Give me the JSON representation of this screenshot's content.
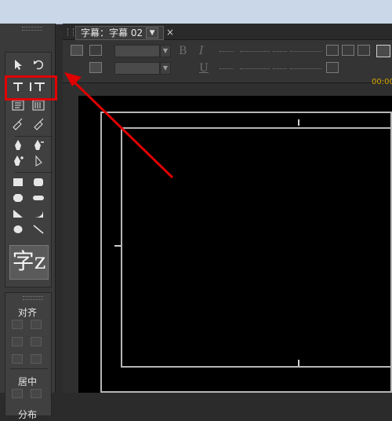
{
  "window": {
    "tab_title": "字幕：字幕 02",
    "tab_menu_symbol": "▼",
    "tab_close_symbol": "×"
  },
  "tools_panel": {
    "tools": [
      {
        "name": "selection-tool",
        "glyph": "↖"
      },
      {
        "name": "rotation-tool",
        "glyph": "↻"
      },
      {
        "name": "type-tool",
        "glyph": "T"
      },
      {
        "name": "vertical-type-tool",
        "glyph": "IT"
      },
      {
        "name": "area-type-tool",
        "glyph": "▤"
      },
      {
        "name": "vertical-area-type-tool",
        "glyph": "▥"
      },
      {
        "name": "path-type-tool",
        "glyph": "⟡"
      },
      {
        "name": "vertical-path-type-tool",
        "glyph": "⟢"
      },
      {
        "name": "pen-tool",
        "glyph": "✒"
      },
      {
        "name": "delete-anchor-tool",
        "glyph": "✒−"
      },
      {
        "name": "add-anchor-tool",
        "glyph": "✒+"
      },
      {
        "name": "convert-anchor-tool",
        "glyph": "⊳"
      },
      {
        "name": "rectangle-tool",
        "glyph": "■"
      },
      {
        "name": "rounded-rectangle-tool",
        "glyph": "▢"
      },
      {
        "name": "clipped-corner-rectangle-tool",
        "glyph": "⬢"
      },
      {
        "name": "rounded-corner-rectangle-tool",
        "glyph": "▬"
      },
      {
        "name": "wedge-tool",
        "glyph": "◣"
      },
      {
        "name": "arc-tool",
        "glyph": "◢"
      },
      {
        "name": "ellipse-tool",
        "glyph": "●"
      },
      {
        "name": "line-tool",
        "glyph": "╲"
      }
    ],
    "preview_text": "字z"
  },
  "align_panel": {
    "align_label": "对齐",
    "center_label": "居中",
    "distribute_label": "分布"
  },
  "toolbar": {
    "bold_label": "B",
    "italic_label": "I",
    "underline_label": "U",
    "timecode": "00:00"
  },
  "colors": {
    "highlight": "#e00000",
    "arrow": "#e00000",
    "panel_bg": "#3a3a3a",
    "canvas_bg": "#000000",
    "safe_area": "#b6b6b6"
  }
}
